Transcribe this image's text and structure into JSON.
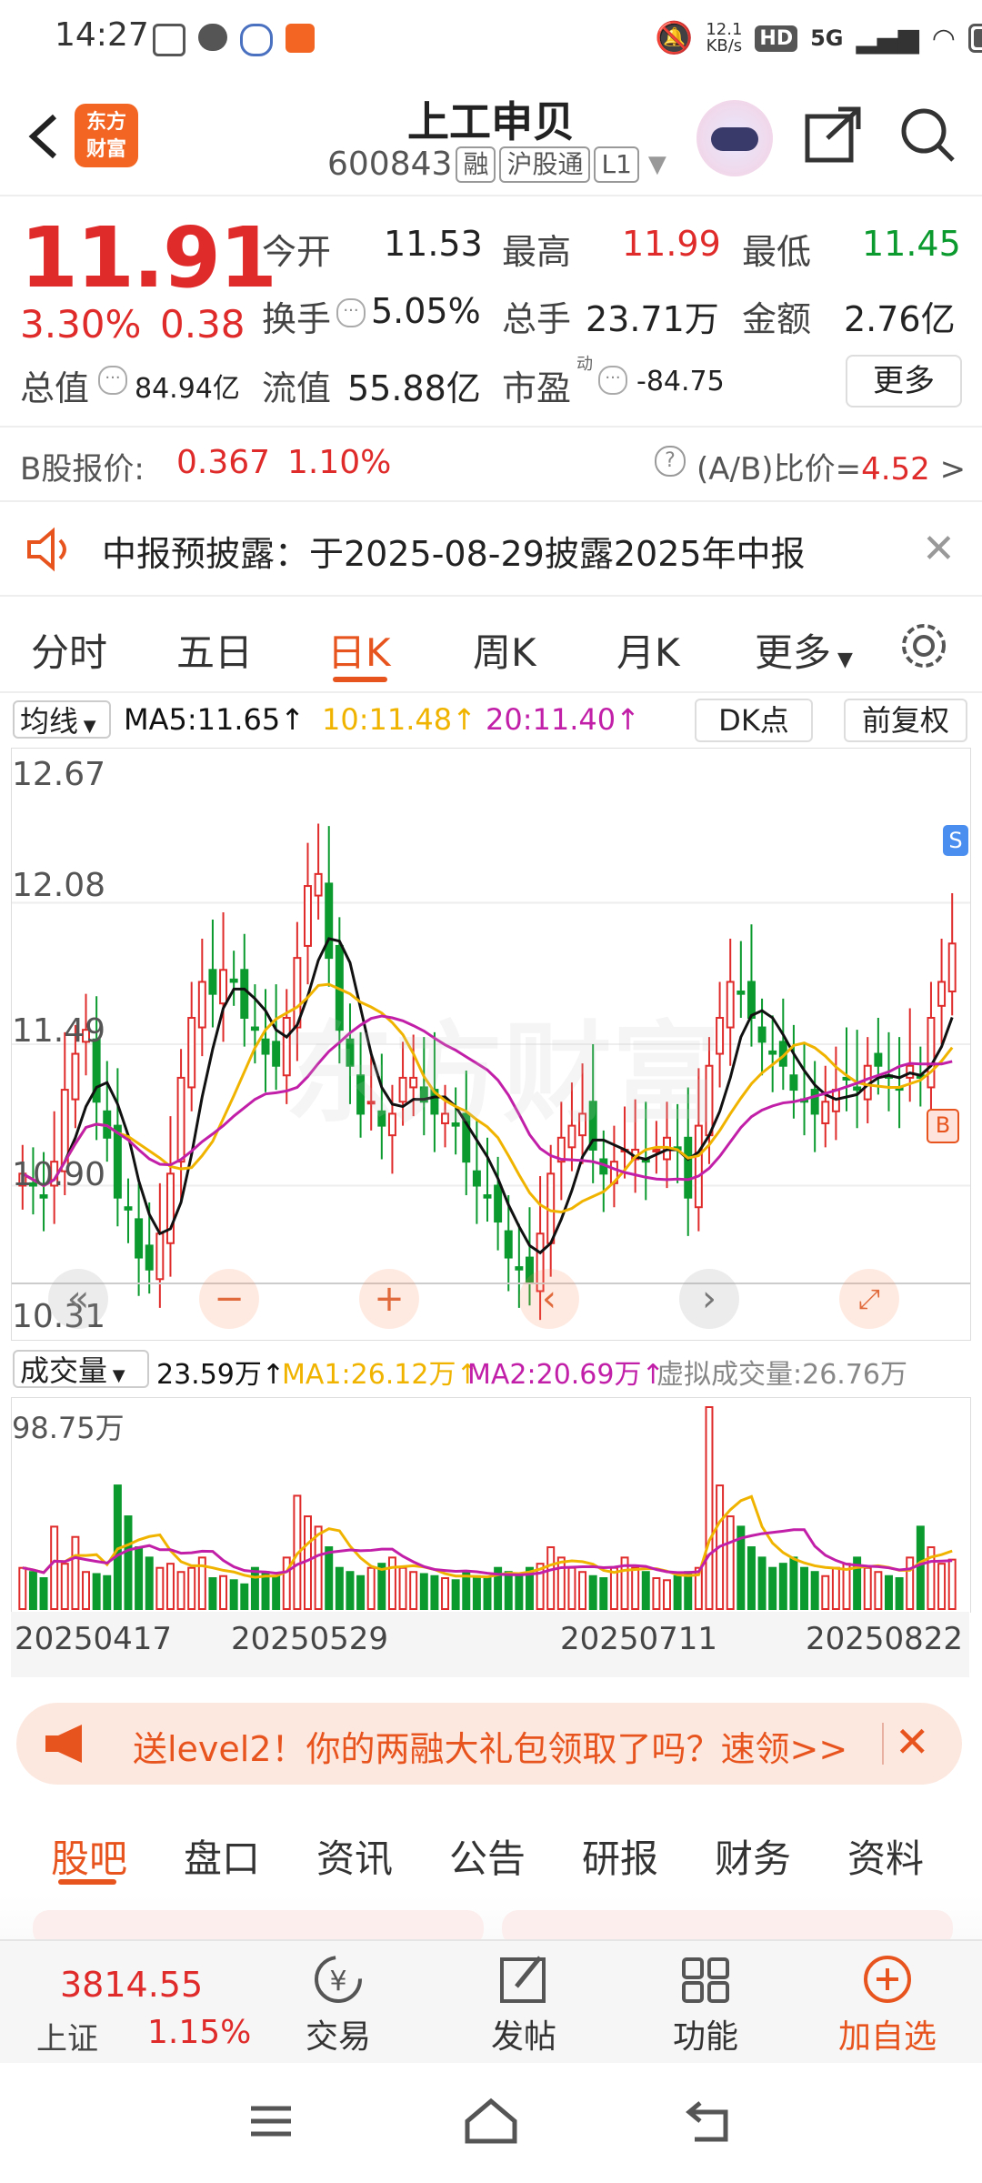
{
  "status_bar": {
    "time": "14:27",
    "net_speed": "12.1\nKB/s",
    "net_speed_top": "12.1",
    "net_speed_bottom": "KB/s",
    "hd": "HD",
    "sig": "5G"
  },
  "header": {
    "title": "上工申贝",
    "code": "600843",
    "tags": [
      "融",
      "沪股通",
      "L1"
    ]
  },
  "quote": {
    "price": "11.91",
    "change_pct": "3.30%",
    "change": "0.38",
    "labels": {
      "open": "今开",
      "high": "最高",
      "low": "最低",
      "turnover": "换手",
      "volume": "总手",
      "amount": "金额",
      "mktcap": "总值",
      "float_cap": "流值",
      "pe": "市盈",
      "pe_sup": "动",
      "more": "更多"
    },
    "open": "11.53",
    "high": "11.99",
    "low": "11.45",
    "turnover": "5.05%",
    "volume": "23.71万",
    "amount": "2.76亿",
    "mktcap": "84.94亿",
    "float_cap": "55.88亿",
    "pe": "-84.75"
  },
  "bshare": {
    "label": "B股报价:",
    "price": "0.367",
    "pct": "1.10%",
    "ratio_label": "(A/B)比价=",
    "ratio": "4.52"
  },
  "notice": {
    "text": "中报预披露：于2025-08-29披露2025年中报"
  },
  "chart_tabs": [
    "分时",
    "五日",
    "日K",
    "周K",
    "月K",
    "更多"
  ],
  "active_tab": "日K",
  "ma_bar": {
    "select": "均线",
    "ma5": "MA5:11.65↑",
    "ma10": "10:11.48↑",
    "ma20": "20:11.40↑",
    "dk": "DK点",
    "fq": "前复权"
  },
  "colors": {
    "up": "#e02b2b",
    "down": "#0a9a2e",
    "ma5": "#111111",
    "ma10": "#f0b400",
    "ma20": "#c21fa8",
    "accent": "#e8541e"
  },
  "chart_data": [
    {
      "type": "candlestick",
      "y_ticks": [
        "12.67",
        "12.08",
        "11.49",
        "10.90",
        "10.31"
      ],
      "ylim": [
        10.31,
        12.67
      ],
      "closes": [
        10.95,
        10.9,
        10.85,
        11.0,
        11.3,
        11.45,
        11.55,
        11.25,
        11.1,
        10.85,
        10.8,
        10.6,
        10.55,
        10.7,
        10.95,
        11.35,
        11.6,
        11.75,
        11.7,
        11.8,
        11.75,
        11.6,
        11.55,
        11.45,
        11.4,
        11.6,
        11.85,
        12.15,
        12.2,
        11.85,
        11.55,
        11.4,
        11.2,
        11.25,
        11.15,
        11.2,
        11.35,
        11.35,
        11.25,
        11.2,
        11.2,
        11.15,
        11.0,
        10.9,
        10.85,
        10.75,
        10.6,
        10.55,
        10.5,
        10.7,
        10.95,
        11.1,
        11.15,
        11.2,
        11.05,
        10.95,
        11.0,
        11.05,
        11.05,
        11.0,
        11.05,
        11.1,
        11.05,
        10.85,
        11.15,
        11.4,
        11.6,
        11.75,
        11.7,
        11.6,
        11.5,
        11.45,
        11.4,
        11.3,
        11.25,
        11.2,
        11.25,
        11.3,
        11.35,
        11.3,
        11.4,
        11.4,
        11.35,
        11.3,
        11.4,
        11.35,
        11.6,
        11.75,
        11.91
      ],
      "ma5": 11.65,
      "ma10": 11.48,
      "ma20": 11.4
    },
    {
      "type": "bar",
      "title": "成交量",
      "y_top_label": "98.75万",
      "x_ticks": [
        "20250417",
        "20250529",
        "20250711",
        "20250822"
      ],
      "volumes": [
        20,
        18,
        15,
        40,
        22,
        35,
        18,
        17,
        16,
        60,
        45,
        30,
        25,
        20,
        22,
        18,
        20,
        25,
        15,
        16,
        14,
        12,
        20,
        18,
        16,
        25,
        55,
        45,
        40,
        30,
        20,
        18,
        16,
        20,
        22,
        25,
        20,
        18,
        17,
        16,
        15,
        14,
        18,
        16,
        15,
        20,
        18,
        17,
        20,
        22,
        30,
        25,
        20,
        18,
        16,
        15,
        20,
        25,
        20,
        18,
        15,
        14,
        16,
        18,
        20,
        98,
        60,
        45,
        40,
        30,
        25,
        20,
        22,
        25,
        20,
        18,
        16,
        20,
        22,
        25,
        20,
        18,
        16,
        15,
        25,
        40,
        30,
        22,
        24
      ],
      "current": "23.59万",
      "ma1": "MA1:26.12万↑",
      "ma2": "MA2:20.69万↑",
      "virtual": "虚拟成交量:26.76万"
    }
  ],
  "vol_bar": {
    "select": "成交量",
    "current": "23.59万↑",
    "ma1": "MA1:26.12万↑",
    "ma2": "MA2:20.69万↑",
    "virtual": "虚拟成交量:26.76万"
  },
  "promo": {
    "text": "送level2！你的两融大礼包领取了吗？速领>>"
  },
  "sub_tabs": [
    "股吧",
    "盘口",
    "资讯",
    "公告",
    "研报",
    "财务",
    "资料"
  ],
  "bottom": {
    "index_value": "3814.55",
    "index_name": "上证",
    "index_pct": "1.15%",
    "items": [
      "交易",
      "发帖",
      "功能",
      "加自选"
    ]
  }
}
